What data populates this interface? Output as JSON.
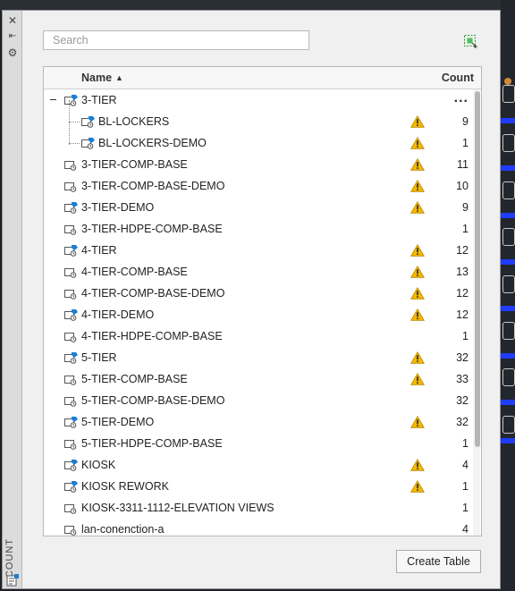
{
  "palette": {
    "side_title": "COUNT",
    "search_placeholder": "Search",
    "columns": {
      "name": "Name",
      "count": "Count"
    },
    "sort": "name-ascending",
    "rows": [
      {
        "name": "3-TIER",
        "count": "",
        "level": 0,
        "expanded": true,
        "icon": "dynamic-block-icon",
        "warning": false,
        "more": "..."
      },
      {
        "name": "BL-LOCKERS",
        "count": "9",
        "level": 1,
        "icon": "dynamic-block-icon",
        "warning": true
      },
      {
        "name": "BL-LOCKERS-DEMO",
        "count": "1",
        "level": 1,
        "icon": "dynamic-block-icon",
        "warning": true
      },
      {
        "name": "3-TIER-COMP-BASE",
        "count": "11",
        "level": 0,
        "icon": "block-icon",
        "warning": true
      },
      {
        "name": "3-TIER-COMP-BASE-DEMO",
        "count": "10",
        "level": 0,
        "icon": "block-icon",
        "warning": true
      },
      {
        "name": "3-TIER-DEMO",
        "count": "9",
        "level": 0,
        "icon": "dynamic-block-icon",
        "warning": true
      },
      {
        "name": "3-TIER-HDPE-COMP-BASE",
        "count": "1",
        "level": 0,
        "icon": "block-icon",
        "warning": false
      },
      {
        "name": "4-TIER",
        "count": "12",
        "level": 0,
        "icon": "dynamic-block-icon",
        "warning": true
      },
      {
        "name": "4-TIER-COMP-BASE",
        "count": "13",
        "level": 0,
        "icon": "block-icon",
        "warning": true
      },
      {
        "name": "4-TIER-COMP-BASE-DEMO",
        "count": "12",
        "level": 0,
        "icon": "block-icon",
        "warning": true
      },
      {
        "name": "4-TIER-DEMO",
        "count": "12",
        "level": 0,
        "icon": "dynamic-block-icon",
        "warning": true
      },
      {
        "name": "4-TIER-HDPE-COMP-BASE",
        "count": "1",
        "level": 0,
        "icon": "block-icon",
        "warning": false
      },
      {
        "name": "5-TIER",
        "count": "32",
        "level": 0,
        "icon": "dynamic-block-icon",
        "warning": true
      },
      {
        "name": "5-TIER-COMP-BASE",
        "count": "33",
        "level": 0,
        "icon": "block-icon",
        "warning": true
      },
      {
        "name": "5-TIER-COMP-BASE-DEMO",
        "count": "32",
        "level": 0,
        "icon": "block-icon",
        "warning": false
      },
      {
        "name": "5-TIER-DEMO",
        "count": "32",
        "level": 0,
        "icon": "dynamic-block-icon",
        "warning": true
      },
      {
        "name": "5-TIER-HDPE-COMP-BASE",
        "count": "1",
        "level": 0,
        "icon": "block-icon",
        "warning": false
      },
      {
        "name": "KIOSK",
        "count": "4",
        "level": 0,
        "icon": "dynamic-block-icon",
        "warning": true
      },
      {
        "name": "KIOSK REWORK",
        "count": "1",
        "level": 0,
        "icon": "dynamic-block-icon",
        "warning": true
      },
      {
        "name": "KIOSK-3311-1112-ELEVATION VIEWS",
        "count": "1",
        "level": 0,
        "icon": "block-icon",
        "warning": false
      },
      {
        "name": "lan-conenction-a",
        "count": "4",
        "level": 0,
        "icon": "block-icon",
        "warning": false
      }
    ],
    "create_table_label": "Create Table"
  },
  "colors": {
    "accent": "#1a7fd4",
    "warning": "#f5b800",
    "panel_bg": "#f0f0f0"
  }
}
